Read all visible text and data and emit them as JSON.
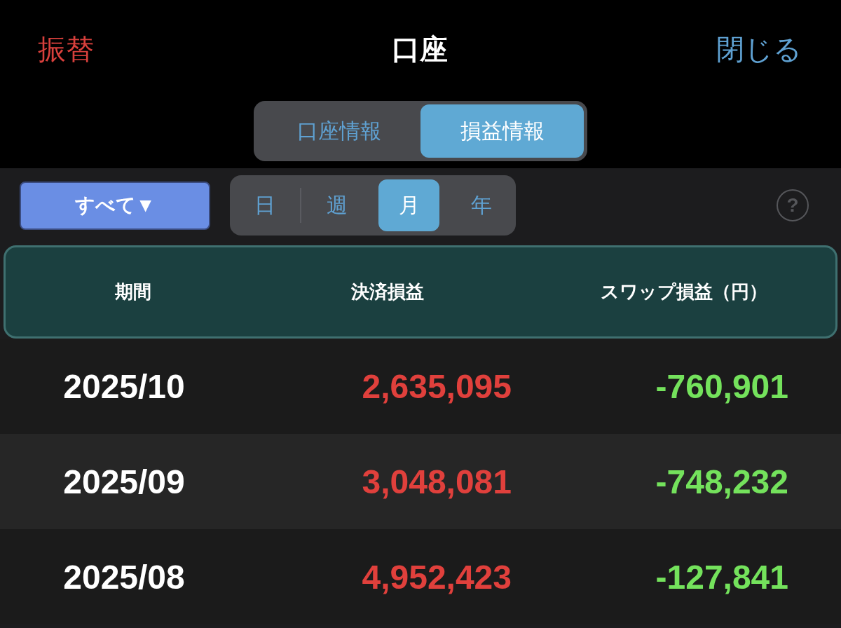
{
  "header": {
    "left_action": "振替",
    "title": "口座",
    "right_action": "閉じる"
  },
  "tabs": [
    {
      "label": "口座情報",
      "selected": false
    },
    {
      "label": "損益情報",
      "selected": true
    }
  ],
  "filter": {
    "label": "すべて▼"
  },
  "periods": [
    {
      "label": "日",
      "selected": false
    },
    {
      "label": "週",
      "selected": false
    },
    {
      "label": "月",
      "selected": true
    },
    {
      "label": "年",
      "selected": false
    }
  ],
  "help": {
    "label": "?"
  },
  "table": {
    "columns": [
      "期間",
      "決済損益",
      "スワップ損益（円）"
    ],
    "rows": [
      {
        "period": "2025/10",
        "settlement_pl": "2,635,095",
        "swap_pl": "-760,901"
      },
      {
        "period": "2025/09",
        "settlement_pl": "3,048,081",
        "swap_pl": "-748,232"
      },
      {
        "period": "2025/08",
        "settlement_pl": "4,952,423",
        "swap_pl": "-127,841"
      }
    ]
  }
}
